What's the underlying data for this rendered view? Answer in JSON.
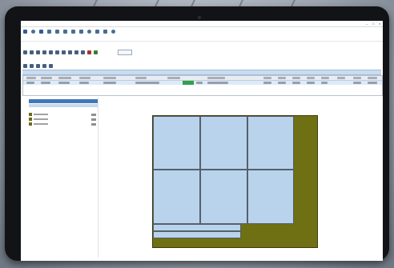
{
  "window": {
    "title": "",
    "controls": [
      "–",
      "□",
      "×"
    ]
  },
  "ribbon": {
    "items": [
      {
        "icon": "file-icon",
        "label": "",
        "color": "#2e5d99"
      },
      {
        "icon": "clock-icon",
        "label": "",
        "color": "#4a6d93"
      },
      {
        "icon": "layout-icon",
        "label": "",
        "color": "#2e5d99"
      },
      {
        "icon": "list-icon",
        "label": "",
        "color": "#4a6d93"
      },
      {
        "icon": "user-icon",
        "label": "",
        "color": "#4a6d93"
      },
      {
        "icon": "user-icon",
        "label": "",
        "color": "#4a6d93"
      },
      {
        "icon": "pen-icon",
        "label": "",
        "color": "#4a6d93"
      },
      {
        "icon": "user-icon",
        "label": "",
        "color": "#4a6d93"
      },
      {
        "icon": "gear-icon",
        "label": "",
        "color": "#4a6d93"
      },
      {
        "icon": "box-icon",
        "label": "",
        "color": "#4a6d93"
      },
      {
        "icon": "lock-icon",
        "label": "",
        "color": "#4a6d93"
      },
      {
        "icon": "globe-icon",
        "label": "",
        "color": "#4a6d93"
      }
    ]
  },
  "subtabs": {
    "label": ""
  },
  "document": {
    "title": "",
    "right_label": ""
  },
  "info_line": "",
  "colors": {
    "accent": "#3e78b8",
    "layout_background": "#6f6f14",
    "panel_fill": "#b9d3ec",
    "selection": "#dcebfb",
    "status_green": "#2fa24a"
  },
  "layout_view": {
    "note": "",
    "dimension_labels": [
      "",
      "",
      "",
      "",
      "",
      "",
      "",
      ""
    ]
  }
}
